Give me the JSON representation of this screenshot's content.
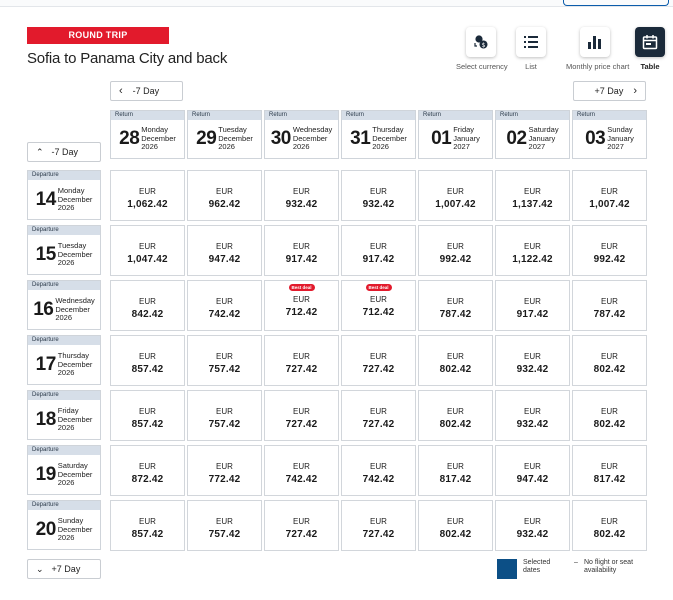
{
  "badge": "ROUND TRIP",
  "route": "Sofia to Panama City and back",
  "views": [
    {
      "label": "Select currency",
      "icon": "currency-icon",
      "active": false
    },
    {
      "label": "List",
      "icon": "list-icon",
      "active": false
    },
    {
      "label": "Monthly price chart",
      "icon": "bar-chart-icon",
      "active": false
    },
    {
      "label": "Table",
      "icon": "calendar-icon",
      "active": true
    }
  ],
  "nav": {
    "prev_return": "-7 Day",
    "next_return": "+7 Day",
    "prev_departure": "-7 Day",
    "next_departure": "+7 Day"
  },
  "return_tag": "Return",
  "departure_tag": "Departure",
  "return_dates": [
    {
      "day": "28",
      "weekday": "Monday",
      "month": "December",
      "year": "2026"
    },
    {
      "day": "29",
      "weekday": "Tuesday",
      "month": "December",
      "year": "2026"
    },
    {
      "day": "30",
      "weekday": "Wednesday",
      "month": "December",
      "year": "2026"
    },
    {
      "day": "31",
      "weekday": "Thursday",
      "month": "December",
      "year": "2026"
    },
    {
      "day": "01",
      "weekday": "Friday",
      "month": "January",
      "year": "2027"
    },
    {
      "day": "02",
      "weekday": "Saturday",
      "month": "January",
      "year": "2027"
    },
    {
      "day": "03",
      "weekday": "Sunday",
      "month": "January",
      "year": "2027"
    }
  ],
  "departure_dates": [
    {
      "day": "14",
      "weekday": "Monday",
      "month": "December",
      "year": "2026"
    },
    {
      "day": "15",
      "weekday": "Tuesday",
      "month": "December",
      "year": "2026"
    },
    {
      "day": "16",
      "weekday": "Wednesday",
      "month": "December",
      "year": "2026"
    },
    {
      "day": "17",
      "weekday": "Thursday",
      "month": "December",
      "year": "2026"
    },
    {
      "day": "18",
      "weekday": "Friday",
      "month": "December",
      "year": "2026"
    },
    {
      "day": "19",
      "weekday": "Saturday",
      "month": "December",
      "year": "2026"
    },
    {
      "day": "20",
      "weekday": "Sunday",
      "month": "December",
      "year": "2026"
    }
  ],
  "currency": "EUR",
  "deal_label": "Best deal",
  "prices": [
    [
      "1,062.42",
      "962.42",
      "932.42",
      "932.42",
      "1,007.42",
      "1,137.42",
      "1,007.42"
    ],
    [
      "1,047.42",
      "947.42",
      "917.42",
      "917.42",
      "992.42",
      "1,122.42",
      "992.42"
    ],
    [
      "842.42",
      "742.42",
      "712.42",
      "712.42",
      "787.42",
      "917.42",
      "787.42"
    ],
    [
      "857.42",
      "757.42",
      "727.42",
      "727.42",
      "802.42",
      "932.42",
      "802.42"
    ],
    [
      "857.42",
      "757.42",
      "727.42",
      "727.42",
      "802.42",
      "932.42",
      "802.42"
    ],
    [
      "872.42",
      "772.42",
      "742.42",
      "742.42",
      "817.42",
      "947.42",
      "817.42"
    ],
    [
      "857.42",
      "757.42",
      "727.42",
      "727.42",
      "802.42",
      "932.42",
      "802.42"
    ]
  ],
  "best_deals": [
    [
      2,
      2
    ],
    [
      2,
      3
    ]
  ],
  "legend": {
    "selected_line1": "Selected",
    "selected_line2": "dates",
    "none_prefix": "–",
    "none_line1": "No flight or seat",
    "none_line2": "availability",
    "selected_color": "#0c4f86"
  }
}
